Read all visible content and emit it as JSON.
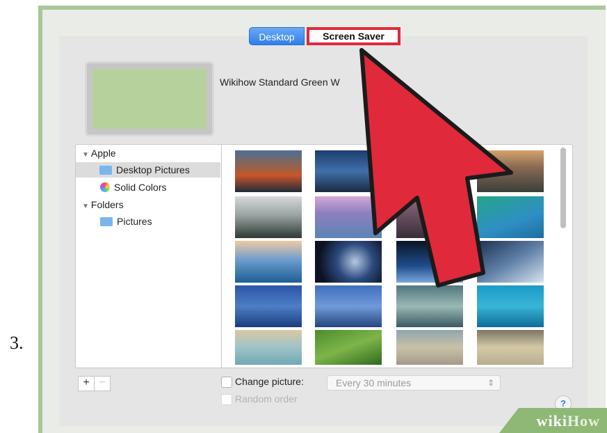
{
  "step_number": "3.",
  "tabs": {
    "desktop": "Desktop",
    "screen_saver": "Screen Saver"
  },
  "wallpaper": {
    "name": "Wikihow Standard Green W"
  },
  "sidebar": {
    "group_apple": "Apple",
    "desktop_pictures": "Desktop Pictures",
    "solid_colors": "Solid Colors",
    "group_folders": "Folders",
    "pictures": "Pictures"
  },
  "controls": {
    "add": "+",
    "remove": "−",
    "change_picture": "Change picture:",
    "interval": "Every 30 minutes",
    "random_order": "Random order",
    "help": "?"
  },
  "watermark": {
    "wiki": "wiki",
    "how": "How"
  },
  "colors": {
    "highlight_red": "#e0293a",
    "accent_blue": "#2f7fe8",
    "wikihow_green": "#8fb876"
  }
}
